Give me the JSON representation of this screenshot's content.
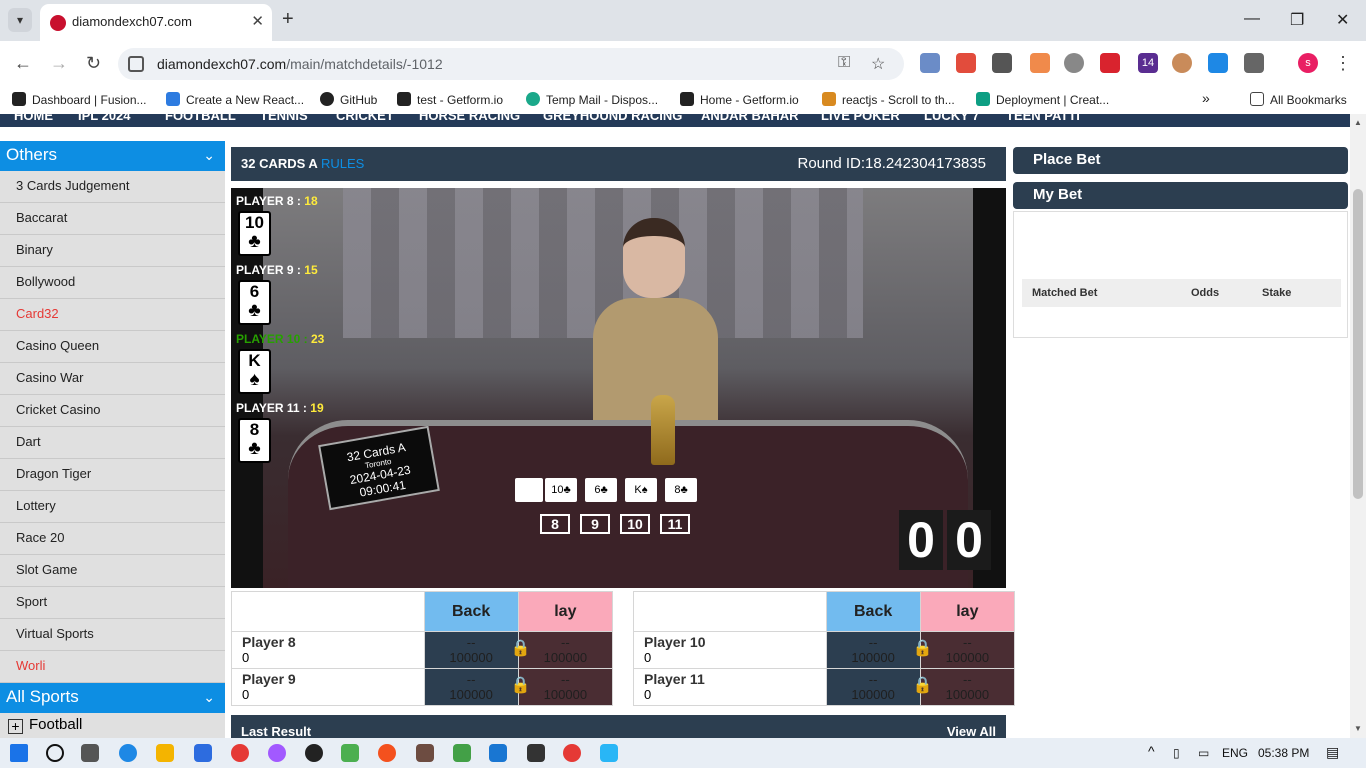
{
  "browser": {
    "tab_title": "diamondexch07.com",
    "url_host": "diamondexch07.com",
    "url_path": "/main/matchdetails/-1012",
    "profile_initial": "s",
    "ext_badge": "14",
    "bookmarks": [
      "Dashboard | Fusion...",
      "Create a New React...",
      "GitHub",
      "test - Getform.io",
      "Temp Mail - Dispos...",
      "Home - Getform.io",
      "reactjs - Scroll to th...",
      "Deployment | Creat..."
    ],
    "all_bookmarks": "All Bookmarks"
  },
  "topnav": [
    "HOME",
    "IPL 2024",
    "FOOTBALL",
    "TENNIS",
    "CRICKET",
    "HORSE RACING",
    "GREYHOUND RACING",
    "ANDAR BAHAR",
    "LIVE POKER",
    "LUCKY 7",
    "TEEN PATTI"
  ],
  "sidebar": {
    "others_title": "Others",
    "items": [
      "3 Cards Judgement",
      "Baccarat",
      "Binary",
      "Bollywood",
      "Card32",
      "Casino Queen",
      "Casino War",
      "Cricket Casino",
      "Dart",
      "Dragon Tiger",
      "Lottery",
      "Race 20",
      "Slot Game",
      "Sport",
      "Virtual Sports",
      "Worli"
    ],
    "all_sports_title": "All Sports",
    "sports": [
      "Football"
    ]
  },
  "game": {
    "title": "32 CARDS A",
    "rules": "RULES",
    "round_id": "Round ID:18.242304173835",
    "players": [
      {
        "label": "PLAYER 8 :",
        "score": "18",
        "rank": "10",
        "suit": "♣",
        "winner": false
      },
      {
        "label": "PLAYER 9 :",
        "score": "15",
        "rank": "6",
        "suit": "♣",
        "winner": false
      },
      {
        "label": "PLAYER 10 :",
        "score": "23",
        "rank": "K",
        "suit": "♠",
        "winner": true
      },
      {
        "label": "PLAYER 11 :",
        "score": "19",
        "rank": "8",
        "suit": "♣",
        "winner": false
      }
    ],
    "sign": {
      "title": "32 Cards A",
      "city": "Toronto",
      "datetime": "2024-04-23 09:00:41"
    },
    "table_cards": [
      "10♣",
      "6♣",
      "K♠",
      "8♣"
    ],
    "table_nums": [
      "8",
      "9",
      "10",
      "11"
    ],
    "timer": [
      "0",
      "0"
    ]
  },
  "betting": {
    "back": "Back",
    "lay": "lay",
    "left": [
      {
        "name": "Player 8",
        "value": "0"
      },
      {
        "name": "Player 9",
        "value": "0"
      }
    ],
    "right": [
      {
        "name": "Player 10",
        "value": "0"
      },
      {
        "name": "Player 11",
        "value": "0"
      }
    ],
    "odds_top": "--",
    "odds_bottom": "100000"
  },
  "last_result": {
    "title": "Last Result",
    "view_all": "View All"
  },
  "right_panel": {
    "place_bet": "Place Bet",
    "my_bet": "My Bet",
    "cols": [
      "Matched Bet",
      "Odds",
      "Stake"
    ]
  },
  "taskbar": {
    "lang": "ENG",
    "time": "05:38 PM"
  }
}
